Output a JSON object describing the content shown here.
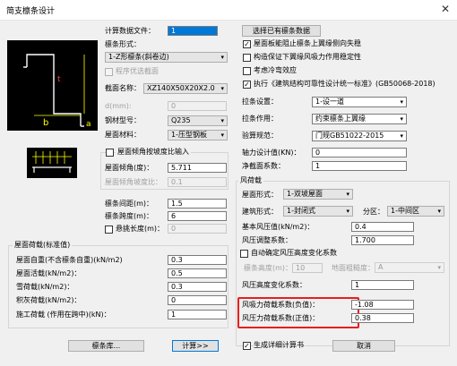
{
  "window": {
    "title": "简支檩条设计",
    "close_glyph": "✕"
  },
  "left": {
    "calc_file_label": "计算数据文件：",
    "calc_file_value": "1",
    "select_data_button": "选择已有檩条数据",
    "purlin_form_label": "檩条形式：",
    "purlin_form_value": "1-Z形檩条(斜卷边)",
    "optimize_label": "程序优选截面",
    "section_label": "截面名称：",
    "section_value": "XZ140X50X20X2.0",
    "d_label": "d(mm):",
    "d_value": "0",
    "steel_label": "钢材型号：",
    "steel_value": "Q235",
    "roof_material_label": "屋面材料：",
    "roof_material_value": "1-压型钢板",
    "slope_check_label": "屋面倾角按坡度比输入",
    "roof_angle_label": "屋面倾角(度)：",
    "roof_angle_value": "5.711",
    "slope_ratio_label": "屋面倾角坡度比：",
    "slope_ratio_value": "0.1",
    "spacing_label": "檩条间距(m)：",
    "spacing_value": "1.5",
    "span_label": "檩条跨度(m)：",
    "span_value": "6",
    "cantilever_label": "悬挑长度(m)：",
    "cantilever_value": "0"
  },
  "loads": {
    "group_title": "屋面荷载(标准值)",
    "dead_label": "屋面自重(不含檩条自重)(kN/m2)",
    "dead_value": "0.3",
    "live_label": "屋面活载(kN/m2)：",
    "live_value": "0.5",
    "snow_label": "雪荷载(kN/m2)：",
    "snow_value": "0.3",
    "ash_label": "积灰荷载(kN/m2)：",
    "ash_value": "0",
    "construction_label": "施工荷载 (作用在跨中)(kN)：",
    "construction_value": "1"
  },
  "right": {
    "chk_roof_panel": "屋面板能阻止檩条上翼缘侧向失稳",
    "chk_structure": "构造保证下翼缘风吸力作用稳定性",
    "chk_oil": "考虑冷弯效应",
    "chk_code": "执行《建筑结构可靠性设计统一标准》(GB50068-2018)",
    "tie_label": "拉条设置：",
    "tie_value": "1-设一道",
    "tie_action_label": "拉条作用：",
    "tie_action_value": "约束檩条上翼缘",
    "check_spec_label": "验算规范：",
    "check_spec_value": "门规GB51022-2015",
    "axial_label": "轴力设计值(KN)：",
    "axial_value": "0",
    "net_section_label": "净截面系数：",
    "net_section_value": "1"
  },
  "wind": {
    "group_title": "风荷载",
    "roof_form_label": "屋面形式：",
    "roof_form_value": "1-双坡屋面",
    "building_form_label": "建筑形式：",
    "building_form_value": "1-封闭式",
    "zone_label": "分区：",
    "zone_value": "1-中间区",
    "basic_pressure_label": "基本风压值(kN/m2)：",
    "basic_pressure_value": "0.4",
    "adjust_label": "风压调整系数：",
    "adjust_value": "1.700",
    "auto_height_label": "自动确定风压高度变化系数",
    "height_label": "檩条高度(m)：",
    "height_value": "10",
    "roughness_label": "地面粗糙度：",
    "roughness_value": "A",
    "height_coef_label": "风压高度变化系数：",
    "height_coef_value": "1",
    "suction_label": "风吸力荷载系数(负值)：",
    "suction_value": "-1.08",
    "pressure_label": "风压力荷载系数(正值)：",
    "pressure_value": "0.38"
  },
  "bottom": {
    "library_button": "檩条库...",
    "calc_button": "计算>>",
    "detail_label": "生成详细计算书",
    "cancel_button": "取消"
  },
  "diagram": {
    "label_b": "b",
    "label_a": "a"
  }
}
